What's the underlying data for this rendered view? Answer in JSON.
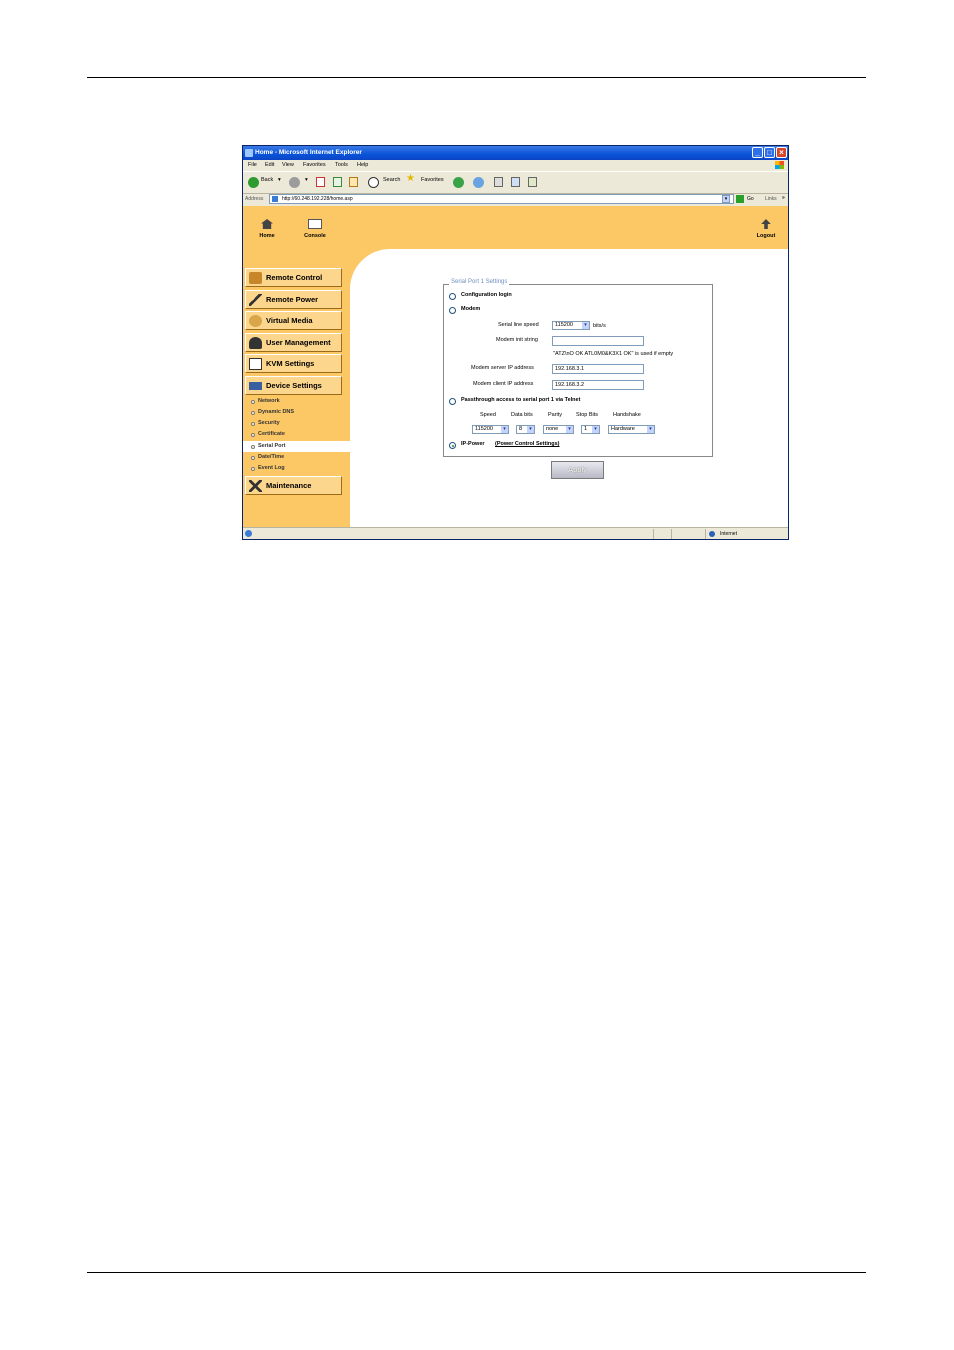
{
  "browser": {
    "title": "Home - Microsoft Internet Explorer",
    "menu": [
      "File",
      "Edit",
      "View",
      "Favorites",
      "Tools",
      "Help"
    ],
    "toolbar": {
      "back": "Back",
      "search": "Search",
      "favorites": "Favorites"
    },
    "address_label": "Address",
    "url": "http://60.248.192.228/home.asp",
    "go": "Go",
    "links": "Links",
    "status_zone": "Internet"
  },
  "topnav": {
    "home": "Home",
    "console": "Console",
    "logout": "Logout"
  },
  "sidebar": {
    "menu": [
      {
        "label": "Remote Control",
        "icon": "remote-control-icon"
      },
      {
        "label": "Remote Power",
        "icon": "power-icon"
      },
      {
        "label": "Virtual Media",
        "icon": "virtual-media-icon"
      },
      {
        "label": "User Management",
        "icon": "users-icon"
      },
      {
        "label": "KVM Settings",
        "icon": "kvm-icon"
      },
      {
        "label": "Device Settings",
        "icon": "device-settings-icon"
      }
    ],
    "subitems": [
      "Network",
      "Dynamic DNS",
      "Security",
      "Certificate",
      "Serial Port",
      "Date/Time",
      "Event Log"
    ],
    "selected_subitem": "Serial Port",
    "maintenance": "Maintenance"
  },
  "settings": {
    "legend": "Serial Port 1 Settings",
    "options": {
      "config_login": "Configuration login",
      "modem": "Modem",
      "passthrough": "Passthrough access to serial port 1 via Telnet",
      "ip_power": "IP-Power",
      "power_control_link": "(Power Control Settings)"
    },
    "selected_option": "IP-Power",
    "modem": {
      "speed_label": "Serial line speed",
      "speed_value": "115200",
      "speed_unit": "bits/s",
      "init_label": "Modem init string",
      "init_value": "",
      "init_hint": "\"ATZ\\nO OK ATL0M0&K3X1 OK\" is used if empty",
      "server_label": "Modem server IP address",
      "server_value": "192.168.3.1",
      "client_label": "Modem client IP address",
      "client_value": "192.168.3.2"
    },
    "passthrough": {
      "headers": [
        "Speed",
        "Data bits",
        "Parity",
        "Stop Bits",
        "Handshake"
      ],
      "values": [
        "115200",
        "8",
        "none",
        "1",
        "Hardware"
      ]
    },
    "apply": "Apply"
  }
}
